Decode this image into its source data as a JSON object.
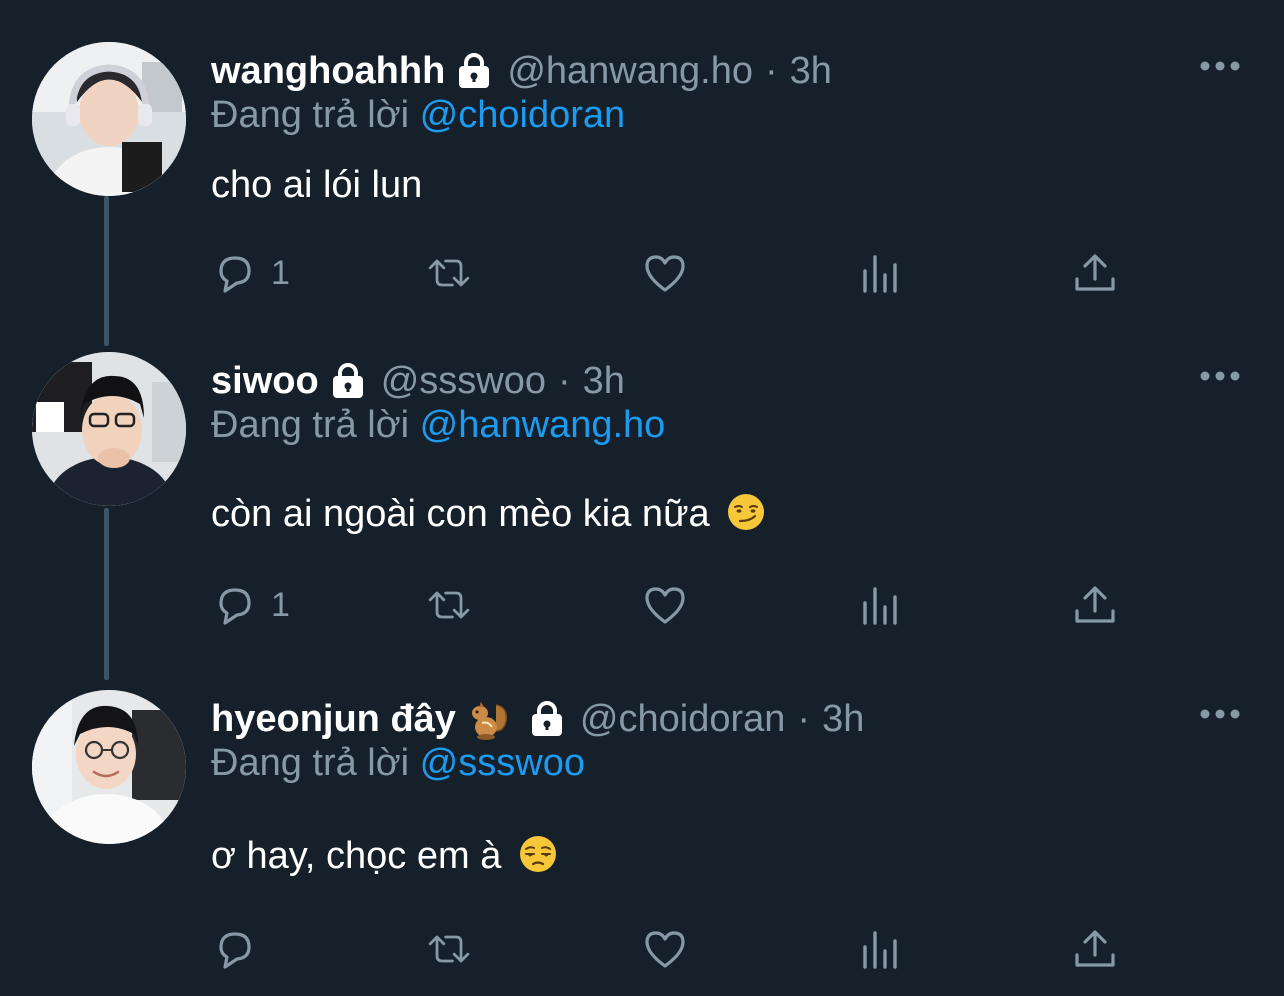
{
  "colors": {
    "background": "#15202b",
    "muted": "#8899a6",
    "link": "#1d9bf0",
    "thread_line": "#3d5466"
  },
  "tweets": [
    {
      "display_name": "wanghoahhh",
      "name_emoji": "",
      "handle": "@hanwang.ho",
      "separator": "·",
      "time": "3h",
      "reply_prefix": "Đang trả lời",
      "reply_to": "@choidoran",
      "text": "cho ai lói lun",
      "text_emoji": "",
      "reply_count": "1",
      "locked": true
    },
    {
      "display_name": "siwoo",
      "name_emoji": "",
      "handle": "@ssswoo",
      "separator": "·",
      "time": "3h",
      "reply_prefix": "Đang trả lời",
      "reply_to": "@hanwang.ho",
      "text": "còn ai ngoài con mèo kia nữa",
      "text_emoji": "smirking-face",
      "reply_count": "1",
      "locked": true
    },
    {
      "display_name": "hyeonjun đây",
      "name_emoji": "🐿",
      "handle": "@choidoran",
      "separator": "·",
      "time": "3h",
      "reply_prefix": "Đang trả lời",
      "reply_to": "@ssswoo",
      "text": "ơ hay, chọc em à",
      "text_emoji": "unamused-face",
      "reply_count": "",
      "locked": true
    }
  ],
  "icons": {
    "reply": "reply-icon",
    "retweet": "retweet-icon",
    "like": "heart-icon",
    "views": "views-icon",
    "share": "share-icon",
    "more": "more-icon",
    "lock": "lock-icon"
  }
}
